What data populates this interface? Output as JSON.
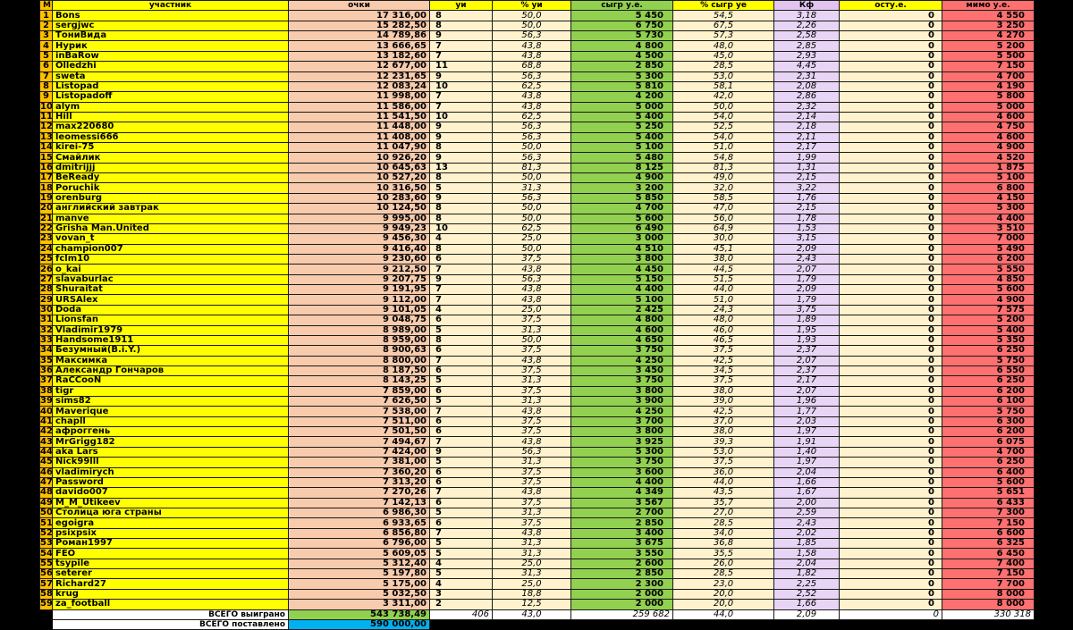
{
  "headers": {
    "m": "М",
    "name": "участник",
    "points": "очки",
    "guessed": "уи",
    "pct_guessed": "% уи",
    "played": "сыгр у.е.",
    "pct_played": "% сыгр уе",
    "kf": "Кф",
    "remainder": "осту.е.",
    "missed": "мимо у.е."
  },
  "rows": [
    {
      "m": "1",
      "name": "Bons",
      "points": "17 316,00",
      "guessed": "8",
      "pct_guessed": "50,0",
      "played": "5 450",
      "pct_played": "54,5",
      "kf": "3,18",
      "remainder": "0",
      "missed": "4 550"
    },
    {
      "m": "2",
      "name": "sergjwc",
      "points": "15 282,50",
      "guessed": "8",
      "pct_guessed": "50,0",
      "played": "6 750",
      "pct_played": "67,5",
      "kf": "2,26",
      "remainder": "0",
      "missed": "3 250"
    },
    {
      "m": "3",
      "name": "ТониВида",
      "points": "14 789,86",
      "guessed": "9",
      "pct_guessed": "56,3",
      "played": "5 730",
      "pct_played": "57,3",
      "kf": "2,58",
      "remainder": "0",
      "missed": "4 270"
    },
    {
      "m": "4",
      "name": "Нурик",
      "points": "13 666,65",
      "guessed": "7",
      "pct_guessed": "43,8",
      "played": "4 800",
      "pct_played": "48,0",
      "kf": "2,85",
      "remainder": "0",
      "missed": "5 200"
    },
    {
      "m": "5",
      "name": "inBaRow",
      "points": "13 182,60",
      "guessed": "7",
      "pct_guessed": "43,8",
      "played": "4 500",
      "pct_played": "45,0",
      "kf": "2,93",
      "remainder": "0",
      "missed": "5 500"
    },
    {
      "m": "6",
      "name": "Olledzhi",
      "points": "12 677,00",
      "guessed": "11",
      "pct_guessed": "68,8",
      "played": "2 850",
      "pct_played": "28,5",
      "kf": "4,45",
      "remainder": "0",
      "missed": "7 150"
    },
    {
      "m": "7",
      "name": "sweta",
      "points": "12 231,65",
      "guessed": "9",
      "pct_guessed": "56,3",
      "played": "5 300",
      "pct_played": "53,0",
      "kf": "2,31",
      "remainder": "0",
      "missed": "4 700"
    },
    {
      "m": "8",
      "name": "Listopad",
      "points": "12 083,24",
      "guessed": "10",
      "pct_guessed": "62,5",
      "played": "5 810",
      "pct_played": "58,1",
      "kf": "2,08",
      "remainder": "0",
      "missed": "4 190"
    },
    {
      "m": "9",
      "name": "Listopadoff",
      "points": "11 998,00",
      "guessed": "7",
      "pct_guessed": "43,8",
      "played": "4 200",
      "pct_played": "42,0",
      "kf": "2,86",
      "remainder": "0",
      "missed": "5 800"
    },
    {
      "m": "10",
      "name": "alym",
      "points": "11 586,00",
      "guessed": "7",
      "pct_guessed": "43,8",
      "played": "5 000",
      "pct_played": "50,0",
      "kf": "2,32",
      "remainder": "0",
      "missed": "5 000"
    },
    {
      "m": "11",
      "name": "Hill",
      "points": "11 541,50",
      "guessed": "10",
      "pct_guessed": "62,5",
      "played": "5 400",
      "pct_played": "54,0",
      "kf": "2,14",
      "remainder": "0",
      "missed": "4 600"
    },
    {
      "m": "12",
      "name": "max220680",
      "points": "11 448,00",
      "guessed": "9",
      "pct_guessed": "56,3",
      "played": "5 250",
      "pct_played": "52,5",
      "kf": "2,18",
      "remainder": "0",
      "missed": "4 750"
    },
    {
      "m": "13",
      "name": "leomessi666",
      "points": "11 408,00",
      "guessed": "9",
      "pct_guessed": "56,3",
      "played": "5 400",
      "pct_played": "54,0",
      "kf": "2,11",
      "remainder": "0",
      "missed": "4 600"
    },
    {
      "m": "14",
      "name": "kirei-75",
      "points": "11 047,90",
      "guessed": "8",
      "pct_guessed": "50,0",
      "played": "5 100",
      "pct_played": "51,0",
      "kf": "2,17",
      "remainder": "0",
      "missed": "4 900"
    },
    {
      "m": "15",
      "name": "Смайлик",
      "points": "10 926,20",
      "guessed": "9",
      "pct_guessed": "56,3",
      "played": "5 480",
      "pct_played": "54,8",
      "kf": "1,99",
      "remainder": "0",
      "missed": "4 520"
    },
    {
      "m": "16",
      "name": "dmitrijjj",
      "points": "10 645,63",
      "guessed": "13",
      "pct_guessed": "81,3",
      "played": "8 125",
      "pct_played": "81,3",
      "kf": "1,31",
      "remainder": "0",
      "missed": "1 875"
    },
    {
      "m": "17",
      "name": "BeReady",
      "points": "10 527,20",
      "guessed": "8",
      "pct_guessed": "50,0",
      "played": "4 900",
      "pct_played": "49,0",
      "kf": "2,15",
      "remainder": "0",
      "missed": "5 100"
    },
    {
      "m": "18",
      "name": "Poruchik",
      "points": "10 316,50",
      "guessed": "5",
      "pct_guessed": "31,3",
      "played": "3 200",
      "pct_played": "32,0",
      "kf": "3,22",
      "remainder": "0",
      "missed": "6 800"
    },
    {
      "m": "19",
      "name": "orenburg",
      "points": "10 283,60",
      "guessed": "9",
      "pct_guessed": "56,3",
      "played": "5 850",
      "pct_played": "58,5",
      "kf": "1,76",
      "remainder": "0",
      "missed": "4 150"
    },
    {
      "m": "20",
      "name": "английский завтрак",
      "points": "10 124,50",
      "guessed": "8",
      "pct_guessed": "50,0",
      "played": "4 700",
      "pct_played": "47,0",
      "kf": "2,15",
      "remainder": "0",
      "missed": "5 300"
    },
    {
      "m": "21",
      "name": "manve",
      "points": "9 995,00",
      "guessed": "8",
      "pct_guessed": "50,0",
      "played": "5 600",
      "pct_played": "56,0",
      "kf": "1,78",
      "remainder": "0",
      "missed": "4 400"
    },
    {
      "m": "22",
      "name": "Grisha Man.United",
      "points": "9 949,23",
      "guessed": "10",
      "pct_guessed": "62,5",
      "played": "6 490",
      "pct_played": "64,9",
      "kf": "1,53",
      "remainder": "0",
      "missed": "3 510"
    },
    {
      "m": "23",
      "name": "vovan_t",
      "points": "9 456,30",
      "guessed": "4",
      "pct_guessed": "25,0",
      "played": "3 000",
      "pct_played": "30,0",
      "kf": "3,15",
      "remainder": "0",
      "missed": "7 000"
    },
    {
      "m": "24",
      "name": "champion007",
      "points": "9 416,40",
      "guessed": "8",
      "pct_guessed": "50,0",
      "played": "4 510",
      "pct_played": "45,1",
      "kf": "2,09",
      "remainder": "0",
      "missed": "5 490"
    },
    {
      "m": "25",
      "name": "fclm10",
      "points": "9 230,60",
      "guessed": "6",
      "pct_guessed": "37,5",
      "played": "3 800",
      "pct_played": "38,0",
      "kf": "2,43",
      "remainder": "0",
      "missed": "6 200"
    },
    {
      "m": "26",
      "name": "o_kai",
      "points": "9 212,50",
      "guessed": "7",
      "pct_guessed": "43,8",
      "played": "4 450",
      "pct_played": "44,5",
      "kf": "2,07",
      "remainder": "0",
      "missed": "5 550"
    },
    {
      "m": "27",
      "name": "slavaburlac",
      "points": "9 207,75",
      "guessed": "9",
      "pct_guessed": "56,3",
      "played": "5 150",
      "pct_played": "51,5",
      "kf": "1,79",
      "remainder": "0",
      "missed": "4 850"
    },
    {
      "m": "28",
      "name": "Shuraitat",
      "points": "9 191,95",
      "guessed": "7",
      "pct_guessed": "43,8",
      "played": "4 400",
      "pct_played": "44,0",
      "kf": "2,09",
      "remainder": "0",
      "missed": "5 600"
    },
    {
      "m": "29",
      "name": "URSAlex",
      "points": "9 112,00",
      "guessed": "7",
      "pct_guessed": "43,8",
      "played": "5 100",
      "pct_played": "51,0",
      "kf": "1,79",
      "remainder": "0",
      "missed": "4 900"
    },
    {
      "m": "30",
      "name": "Doda",
      "points": "9 101,05",
      "guessed": "4",
      "pct_guessed": "25,0",
      "played": "2 425",
      "pct_played": "24,3",
      "kf": "3,75",
      "remainder": "0",
      "missed": "7 575"
    },
    {
      "m": "31",
      "name": "Lionsfan",
      "points": "9 048,75",
      "guessed": "6",
      "pct_guessed": "37,5",
      "played": "4 800",
      "pct_played": "48,0",
      "kf": "1,89",
      "remainder": "0",
      "missed": "5 200"
    },
    {
      "m": "32",
      "name": "Vladimir1979",
      "points": "8 989,00",
      "guessed": "5",
      "pct_guessed": "31,3",
      "played": "4 600",
      "pct_played": "46,0",
      "kf": "1,95",
      "remainder": "0",
      "missed": "5 400"
    },
    {
      "m": "33",
      "name": "Handsome1911",
      "points": "8 959,00",
      "guessed": "8",
      "pct_guessed": "50,0",
      "played": "4 650",
      "pct_played": "46,5",
      "kf": "1,93",
      "remainder": "0",
      "missed": "5 350"
    },
    {
      "m": "34",
      "name": "Безумный(B.i.Y.)",
      "points": "8 900,63",
      "guessed": "6",
      "pct_guessed": "37,5",
      "played": "3 750",
      "pct_played": "37,5",
      "kf": "2,37",
      "remainder": "0",
      "missed": "6 250"
    },
    {
      "m": "35",
      "name": "Максимка",
      "points": "8 800,00",
      "guessed": "7",
      "pct_guessed": "43,8",
      "played": "4 250",
      "pct_played": "42,5",
      "kf": "2,07",
      "remainder": "0",
      "missed": "5 750"
    },
    {
      "m": "36",
      "name": "Александр Гончаров",
      "points": "8 187,50",
      "guessed": "6",
      "pct_guessed": "37,5",
      "played": "3 450",
      "pct_played": "34,5",
      "kf": "2,37",
      "remainder": "0",
      "missed": "6 550"
    },
    {
      "m": "37",
      "name": "RaCCooN",
      "points": "8 143,25",
      "guessed": "5",
      "pct_guessed": "31,3",
      "played": "3 750",
      "pct_played": "37,5",
      "kf": "2,17",
      "remainder": "0",
      "missed": "6 250"
    },
    {
      "m": "38",
      "name": "tigr",
      "points": "7 859,00",
      "guessed": "6",
      "pct_guessed": "37,5",
      "played": "3 800",
      "pct_played": "38,0",
      "kf": "2,07",
      "remainder": "0",
      "missed": "6 200"
    },
    {
      "m": "39",
      "name": "sims82",
      "points": "7 626,50",
      "guessed": "5",
      "pct_guessed": "31,3",
      "played": "3 900",
      "pct_played": "39,0",
      "kf": "1,96",
      "remainder": "0",
      "missed": "6 100"
    },
    {
      "m": "40",
      "name": "Maverique",
      "points": "7 538,00",
      "guessed": "7",
      "pct_guessed": "43,8",
      "played": "4 250",
      "pct_played": "42,5",
      "kf": "1,77",
      "remainder": "0",
      "missed": "5 750"
    },
    {
      "m": "41",
      "name": "chapll",
      "points": "7 511,00",
      "guessed": "6",
      "pct_guessed": "37,5",
      "played": "3 700",
      "pct_played": "37,0",
      "kf": "2,03",
      "remainder": "0",
      "missed": "6 300"
    },
    {
      "m": "42",
      "name": "афроггень",
      "points": "7 501,50",
      "guessed": "6",
      "pct_guessed": "37,5",
      "played": "3 800",
      "pct_played": "38,0",
      "kf": "1,97",
      "remainder": "0",
      "missed": "6 200"
    },
    {
      "m": "43",
      "name": "MrGrigg182",
      "points": "7 494,67",
      "guessed": "7",
      "pct_guessed": "43,8",
      "played": "3 925",
      "pct_played": "39,3",
      "kf": "1,91",
      "remainder": "0",
      "missed": "6 075"
    },
    {
      "m": "44",
      "name": "aka Lars",
      "points": "7 424,00",
      "guessed": "9",
      "pct_guessed": "56,3",
      "played": "5 300",
      "pct_played": "53,0",
      "kf": "1,40",
      "remainder": "0",
      "missed": "4 700"
    },
    {
      "m": "45",
      "name": "Nick99lll",
      "points": "7 381,00",
      "guessed": "5",
      "pct_guessed": "31,3",
      "played": "3 750",
      "pct_played": "37,5",
      "kf": "1,97",
      "remainder": "0",
      "missed": "6 250"
    },
    {
      "m": "46",
      "name": "vladimirych",
      "points": "7 360,20",
      "guessed": "6",
      "pct_guessed": "37,5",
      "played": "3 600",
      "pct_played": "36,0",
      "kf": "2,04",
      "remainder": "0",
      "missed": "6 400"
    },
    {
      "m": "47",
      "name": "Password",
      "points": "7 313,20",
      "guessed": "6",
      "pct_guessed": "37,5",
      "played": "4 400",
      "pct_played": "44,0",
      "kf": "1,66",
      "remainder": "0",
      "missed": "5 600"
    },
    {
      "m": "48",
      "name": "davido007",
      "points": "7 270,26",
      "guessed": "7",
      "pct_guessed": "43,8",
      "played": "4 349",
      "pct_played": "43,5",
      "kf": "1,67",
      "remainder": "0",
      "missed": "5 651"
    },
    {
      "m": "49",
      "name": "M_M_Utikeev",
      "points": "7 142,13",
      "guessed": "6",
      "pct_guessed": "37,5",
      "played": "3 567",
      "pct_played": "35,7",
      "kf": "2,00",
      "remainder": "0",
      "missed": "6 433"
    },
    {
      "m": "50",
      "name": "Столица юга страны",
      "points": "6 986,30",
      "guessed": "5",
      "pct_guessed": "31,3",
      "played": "2 700",
      "pct_played": "27,0",
      "kf": "2,59",
      "remainder": "0",
      "missed": "7 300"
    },
    {
      "m": "51",
      "name": "egoigra",
      "points": "6 933,65",
      "guessed": "6",
      "pct_guessed": "37,5",
      "played": "2 850",
      "pct_played": "28,5",
      "kf": "2,43",
      "remainder": "0",
      "missed": "7 150"
    },
    {
      "m": "52",
      "name": "psixpsix",
      "points": "6 856,80",
      "guessed": "7",
      "pct_guessed": "43,8",
      "played": "3 400",
      "pct_played": "34,0",
      "kf": "2,02",
      "remainder": "0",
      "missed": "6 600"
    },
    {
      "m": "53",
      "name": "Роман1997",
      "points": "6 796,00",
      "guessed": "5",
      "pct_guessed": "31,3",
      "played": "3 675",
      "pct_played": "36,8",
      "kf": "1,85",
      "remainder": "0",
      "missed": "6 325"
    },
    {
      "m": "54",
      "name": "FEO",
      "points": "5 609,05",
      "guessed": "5",
      "pct_guessed": "31,3",
      "played": "3 550",
      "pct_played": "35,5",
      "kf": "1,58",
      "remainder": "0",
      "missed": "6 450"
    },
    {
      "m": "55",
      "name": "tsypile",
      "points": "5 312,40",
      "guessed": "4",
      "pct_guessed": "25,0",
      "played": "2 600",
      "pct_played": "26,0",
      "kf": "2,04",
      "remainder": "0",
      "missed": "7 400"
    },
    {
      "m": "56",
      "name": "seterer",
      "points": "5 197,80",
      "guessed": "5",
      "pct_guessed": "31,3",
      "played": "2 850",
      "pct_played": "28,5",
      "kf": "1,82",
      "remainder": "0",
      "missed": "7 150"
    },
    {
      "m": "57",
      "name": "Richard27",
      "points": "5 175,00",
      "guessed": "4",
      "pct_guessed": "25,0",
      "played": "2 300",
      "pct_played": "23,0",
      "kf": "2,25",
      "remainder": "0",
      "missed": "7 700"
    },
    {
      "m": "58",
      "name": "krug",
      "points": "5 032,50",
      "guessed": "3",
      "pct_guessed": "18,8",
      "played": "2 000",
      "pct_played": "20,0",
      "kf": "2,52",
      "remainder": "0",
      "missed": "8 000"
    },
    {
      "m": "59",
      "name": "za_football",
      "points": "3 311,00",
      "guessed": "2",
      "pct_guessed": "12,5",
      "played": "2 000",
      "pct_played": "20,0",
      "kf": "1,66",
      "remainder": "0",
      "missed": "8 000"
    }
  ],
  "totals": {
    "won_label": "ВСЕГО выиграно",
    "won_value": "543 738,49",
    "guessed_total": "406",
    "pct_guessed_total": "43,0",
    "played_total": "259 682",
    "pct_played_total": "44,0",
    "kf_total": "2,09",
    "remainder_total": "0",
    "missed_total": "330 318",
    "bet_label": "ВСЕГО поставлено",
    "bet_value": "590 000,00"
  },
  "colors": {
    "rank": "#ffc000",
    "name": "#ffff00",
    "points": "#f8cbad",
    "played": "#92d050",
    "kf": "#e8d5f5",
    "missed": "#ff7070",
    "bet_total": "#00b0f0"
  }
}
